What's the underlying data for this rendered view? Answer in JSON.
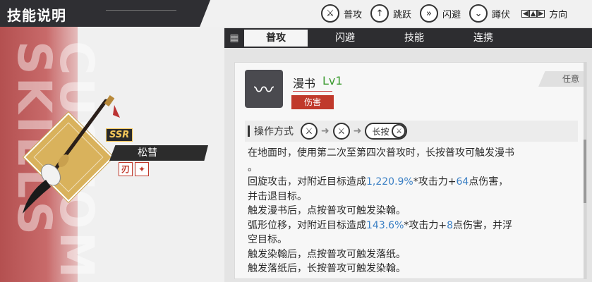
{
  "header": {
    "title": "技能说明"
  },
  "controls": [
    {
      "icon": "attack-icon",
      "glyph": "⚔",
      "label": "普攻"
    },
    {
      "icon": "jump-icon",
      "glyph": "↑",
      "label": "跳跃"
    },
    {
      "icon": "dodge-icon",
      "glyph": "»",
      "label": "闪避"
    },
    {
      "icon": "crouch-icon",
      "glyph": "⌄",
      "label": "蹲伏"
    }
  ],
  "direction_label": "方向",
  "weapon": {
    "rarity": "SSR",
    "name": "松彗",
    "bg_text": "CUSTOM SKILLS"
  },
  "tabs": [
    {
      "label": "普攻",
      "active": true
    },
    {
      "label": "闪避",
      "active": false
    },
    {
      "label": "技能",
      "active": false
    },
    {
      "label": "连携",
      "active": false
    }
  ],
  "skill": {
    "name": "漫书",
    "level": "Lv1",
    "type_badge": "伤害",
    "corner_tag": "任意",
    "operation_label": "操作方式",
    "hold_label": "长按",
    "desc": {
      "l1": "在地面时，使用第二次至第四次普攻时，长按普攻可触发漫书",
      "l2": "。",
      "l3a": "回旋攻击，对附近目标造成",
      "l3n1": "1,220.9%",
      "l3b": "*攻击力+",
      "l3n2": "64",
      "l3c": "点伤害，",
      "l4": "并击退目标。",
      "l5": "触发漫书后，点按普攻可触发染翰。",
      "l6a": "弧形位移，对附近目标造成",
      "l6n1": "143.6%",
      "l6b": "*攻击力+",
      "l6n2": "8",
      "l6c": "点伤害，并浮",
      "l7": "空目标。",
      "l8": "触发染翰后，点按普攻可触发落纸。",
      "l9": "触发落纸后，长按普攻可触发染翰。"
    }
  },
  "colors": {
    "damage_badge": "#c0392b",
    "level": "#3a9a2e",
    "number": "#3a7fc4",
    "rarity": "#f2c65a"
  }
}
